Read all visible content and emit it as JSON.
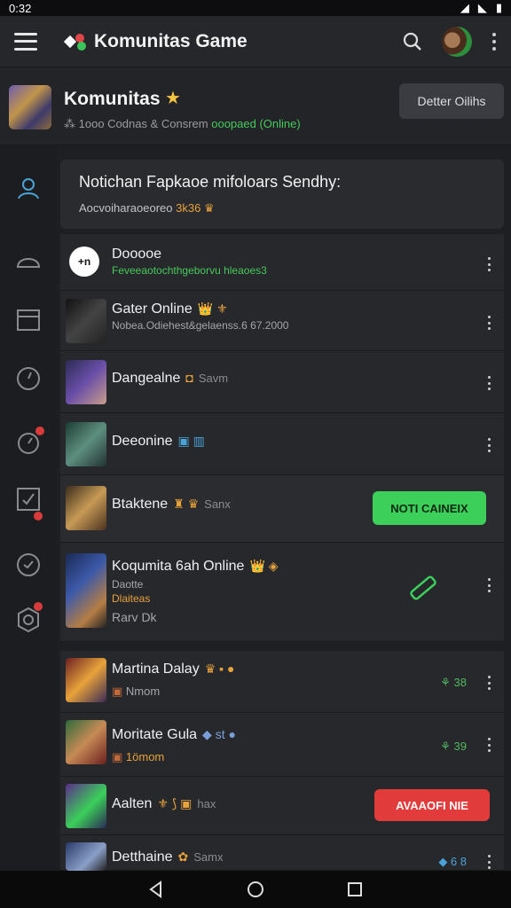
{
  "status_bar": {
    "time": "0:32"
  },
  "app_bar": {
    "title": "Komunitas Game",
    "logo_icon": "puzzle-logo-icon",
    "search_icon": "search-icon",
    "more_icon": "more-vert-icon"
  },
  "community": {
    "name": "Komunitas",
    "star_icon": "star-icon",
    "stats_prefix": "1ooo Codnas & Consrem",
    "stats_online": "ooopaed (Online)",
    "detail_button": "Detter Oilihs"
  },
  "notice": {
    "title": "Notichan Fapkaoe mifoloars Sendhy:",
    "sub": "Aocvoiharaoeoreo",
    "sub_highlight": "3k36"
  },
  "rows": [
    {
      "name": "Dooooe",
      "sub": "Feveeaotochthgeborvu hleaoes3",
      "sub_color": "#46c95a",
      "badge": "",
      "muted": ""
    },
    {
      "name": "Gater Online",
      "sub": "Nobea.Odiehest&gelaenss.6 67.2000",
      "badge": "👑 ⚜",
      "muted": ""
    },
    {
      "name": "Dangealne",
      "sub": "",
      "badge": "◘",
      "muted": "Savm"
    },
    {
      "name": "Deeonine",
      "sub": "",
      "badge": "▣ ▥",
      "muted": ""
    },
    {
      "name": "Btaktene",
      "sub": "",
      "badge": "♜ ♛",
      "muted": "Sanx",
      "button": "NOTI CAINEIX"
    },
    {
      "name": "Koqumita 6ah Online",
      "sub": "Daotte",
      "sub2": "Dlaiteas",
      "sub3": "Rarv Dk",
      "badge": "👑 ◈",
      "muted": ""
    },
    {
      "name": "Martina Dalay",
      "sub": "Nmom",
      "badge": "♛ ▪ ●",
      "muted": "",
      "rstat": "⚘ 38"
    },
    {
      "name": "Moritate Gula",
      "sub": "1ömom",
      "badge": "◆ st ●",
      "muted": "",
      "rstat": "⚘ 39"
    },
    {
      "name": "Aalten",
      "sub": "",
      "badge": "⚜ ⟆ ▣",
      "muted": "hax",
      "button": "AVAAOFI NIE"
    },
    {
      "name": "Detthaine",
      "sub": "",
      "badge": "✿",
      "muted": "Samx",
      "rstat": "◆ 6 8"
    }
  ],
  "colors": {
    "background": "#1e1f22",
    "green_accent": "#3ccf5a",
    "red_accent": "#e23b3b",
    "gold_accent": "#e8a23b"
  }
}
